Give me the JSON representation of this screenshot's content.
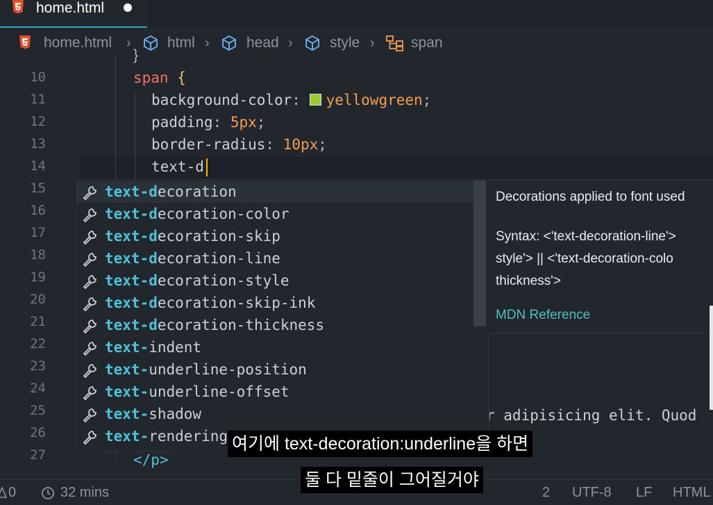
{
  "tab": {
    "filename": "home.html"
  },
  "breadcrumb": {
    "file": "home.html",
    "items": [
      "html",
      "head",
      "style",
      "span"
    ]
  },
  "editor": {
    "line_numbers": [
      "10",
      "11",
      "12",
      "13",
      "14",
      "15",
      "16",
      "17",
      "18",
      "19",
      "20",
      "21",
      "22",
      "23",
      "24",
      "25",
      "26",
      "27"
    ],
    "selector": "span",
    "open_brace": "{",
    "lines": [
      {
        "prop": "background-color",
        "value": "yellowgreen",
        "swatch": "#9acd32"
      },
      {
        "prop": "padding",
        "value": "5px"
      },
      {
        "prop": "border-radius",
        "value": "10px"
      }
    ],
    "typing": "text-d",
    "bg_text": "r adipisicing elit. Quod",
    "closing_tag": "</p>"
  },
  "suggest": {
    "items": [
      {
        "prefix": "text-",
        "match": "d",
        "rest": "ecoration"
      },
      {
        "prefix": "text-",
        "match": "d",
        "rest": "ecoration-color"
      },
      {
        "prefix": "text-",
        "match": "d",
        "rest": "ecoration-skip"
      },
      {
        "prefix": "text-",
        "match": "d",
        "rest": "ecoration-line"
      },
      {
        "prefix": "text-",
        "match": "d",
        "rest": "ecoration-style"
      },
      {
        "prefix": "text-",
        "match": "d",
        "rest": "ecoration-skip-ink"
      },
      {
        "prefix": "text-",
        "match": "d",
        "rest": "ecoration-thickness"
      },
      {
        "prefix": "text-",
        "match": "",
        "rest": "indent"
      },
      {
        "prefix": "text-",
        "match": "",
        "rest": "underline-position"
      },
      {
        "prefix": "text-",
        "match": "",
        "rest": "underline-offset"
      },
      {
        "prefix": "text-",
        "match": "",
        "rest": "shadow"
      },
      {
        "prefix": "text-",
        "match": "",
        "rest": "rendering"
      }
    ],
    "icon": "wrench-icon"
  },
  "details": {
    "title": "Decorations applied to font used",
    "syntax_lines": [
      "Syntax: <'text-decoration-line'>",
      "style'> || <'text-decoration-colo",
      "thickness'>"
    ],
    "link": "MDN Reference"
  },
  "captions": {
    "line1": "여기에 text-decoration:underline을 하면",
    "line2": "둘 다 밑줄이 그어질거야"
  },
  "statusbar": {
    "errors": "0",
    "time": "32 mins",
    "spaces": "2",
    "encoding": "UTF-8",
    "eol": "LF",
    "language": "HTML"
  }
}
